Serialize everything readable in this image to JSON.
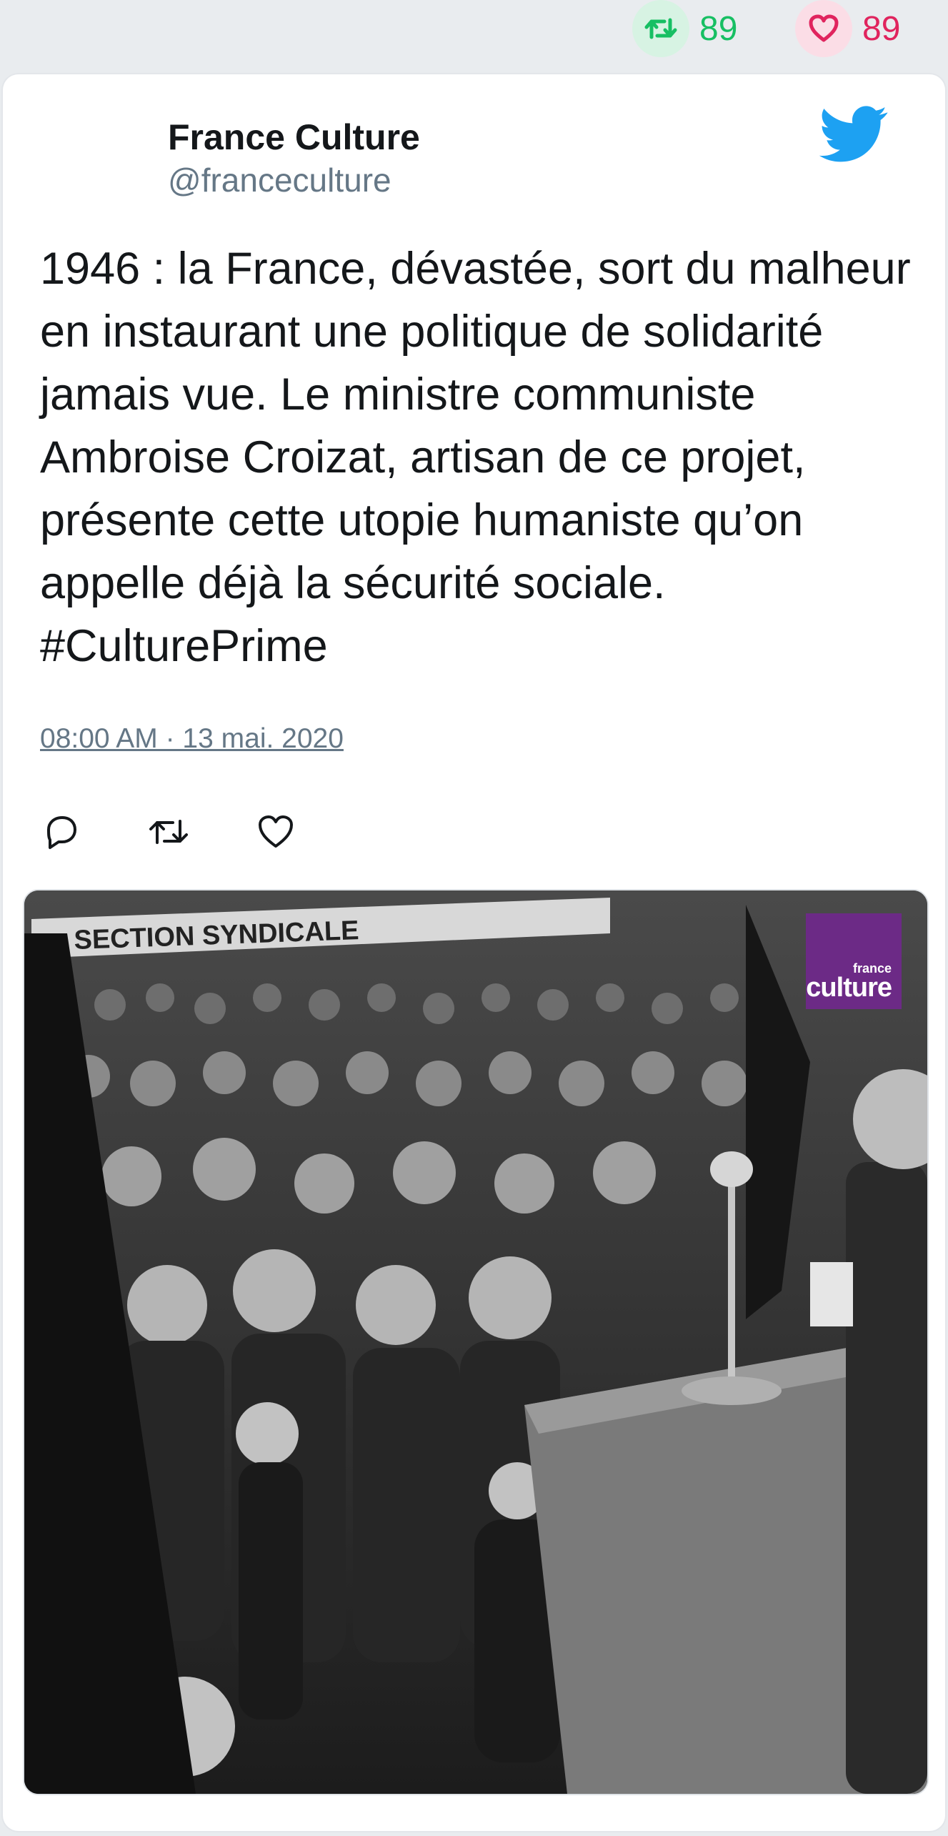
{
  "stats": {
    "retweets": "89",
    "likes": "89",
    "retweet_color": "#17bf63",
    "like_color": "#e0245e"
  },
  "tweet": {
    "author_name": "France Culture",
    "author_handle": "@franceculture",
    "text": "1946 : la France, dévastée, sort du malheur en instaurant une politique de solidarité jamais vue. Le ministre communiste Ambroise Croizat, artisan de ce projet, présente cette utopie humaniste qu’on appelle déjà la sécurité sociale. #CulturePrime",
    "timestamp": "08:00 AM · 13 mai. 2020",
    "icons": {
      "brand": "twitter-bird-icon",
      "reply": "reply-icon",
      "retweet": "retweet-icon",
      "like": "heart-icon"
    },
    "accent_color": "#1da1f2"
  },
  "media": {
    "banner_text": "SECTION SYNDICALE",
    "logo_small": "france",
    "logo_big": "culture",
    "logo_color": "#6c2a86"
  }
}
